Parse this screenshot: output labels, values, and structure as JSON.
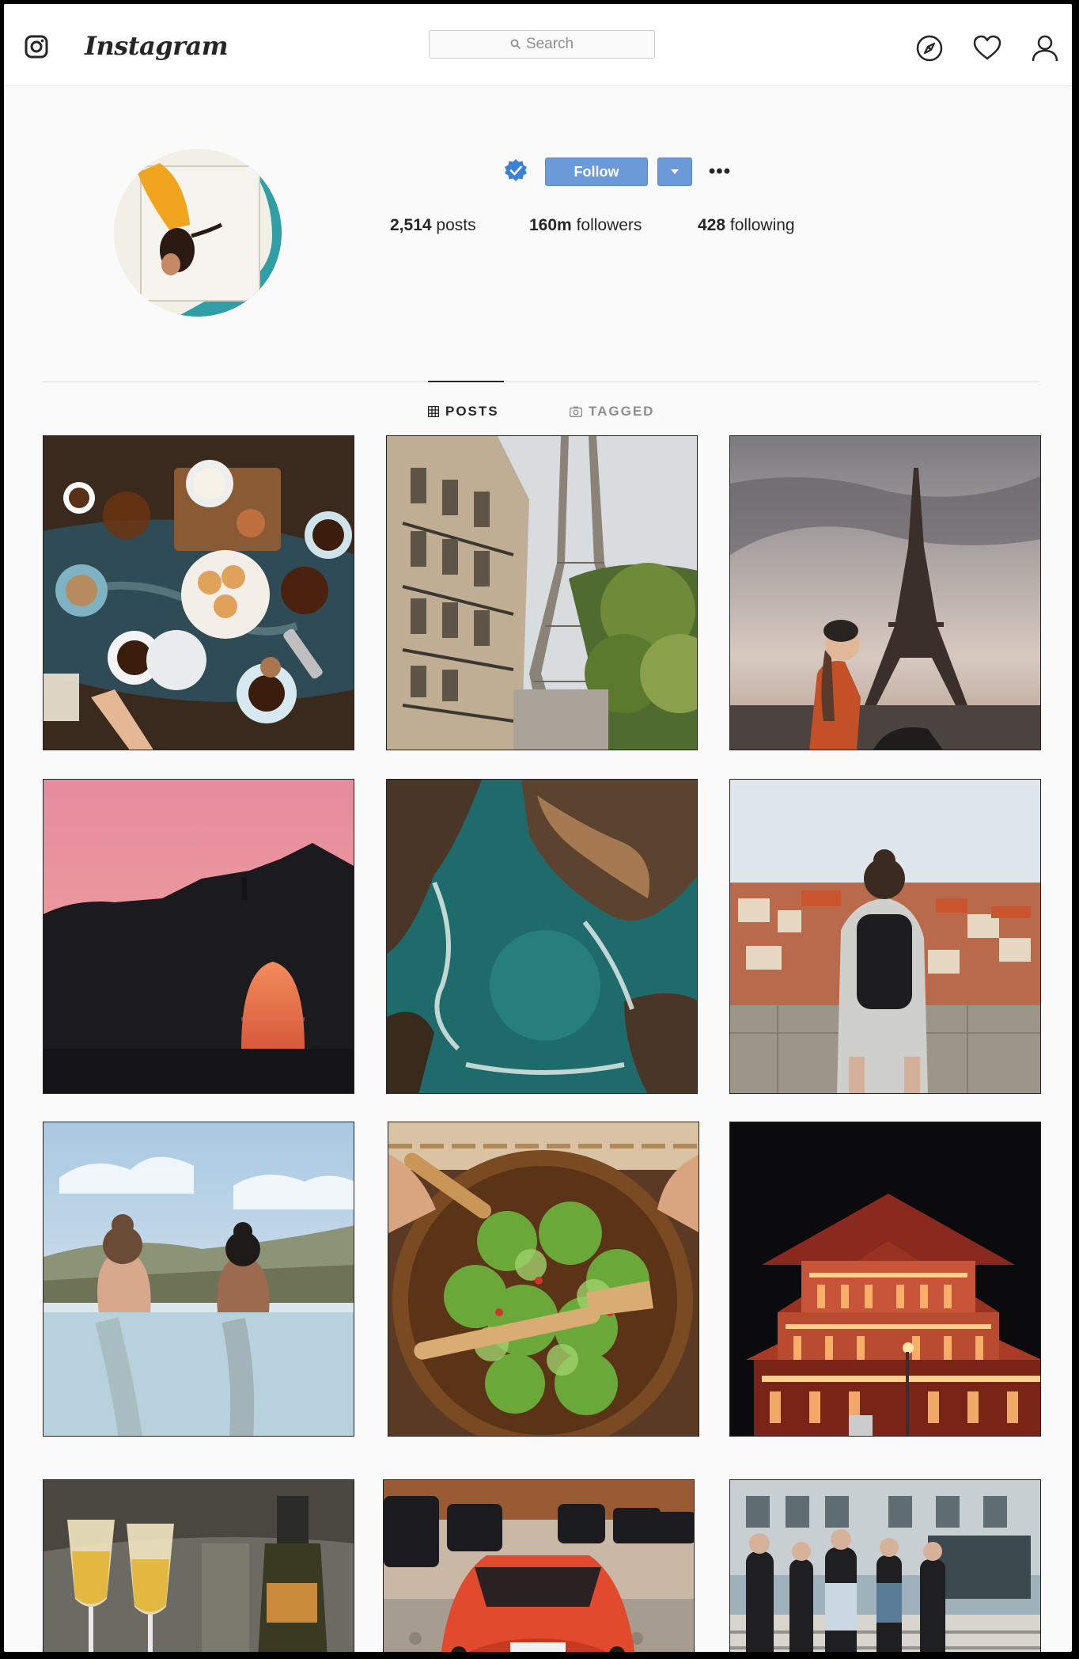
{
  "header": {
    "logo_text": "Instagram",
    "search_placeholder": "Search",
    "icons": [
      "instagram-camera-icon",
      "compass-icon",
      "heart-icon",
      "user-icon"
    ]
  },
  "profile": {
    "follow_label": "Follow",
    "more_label": "•••",
    "verified_icon": "verified-badge-icon",
    "stats": {
      "posts_count": "2,514",
      "posts_label": "posts",
      "followers_count": "160m",
      "followers_label": "followers",
      "following_count": "428",
      "following_label": "following"
    }
  },
  "tabs": [
    {
      "label": "POSTS",
      "active": true,
      "icon": "grid-icon"
    },
    {
      "label": "TAGGED",
      "active": false,
      "icon": "tag-camera-icon"
    }
  ],
  "posts": [
    "coffee-table",
    "paris-street-eiffel",
    "eiffel-woman",
    "pink-sunset-arch",
    "ocean-rocks-aerial",
    "dubrovnik-backpacker",
    "infinity-pool-women",
    "salad-bowl",
    "chinese-temple-night",
    "champagne-glasses",
    "red-sports-car",
    "street-crowd"
  ],
  "colors": {
    "accent_blue": "#6a9bd8",
    "verified_blue": "#3b82d6",
    "text_dark": "#262626",
    "text_muted": "#8e8e8e",
    "background": "#fafafa"
  }
}
